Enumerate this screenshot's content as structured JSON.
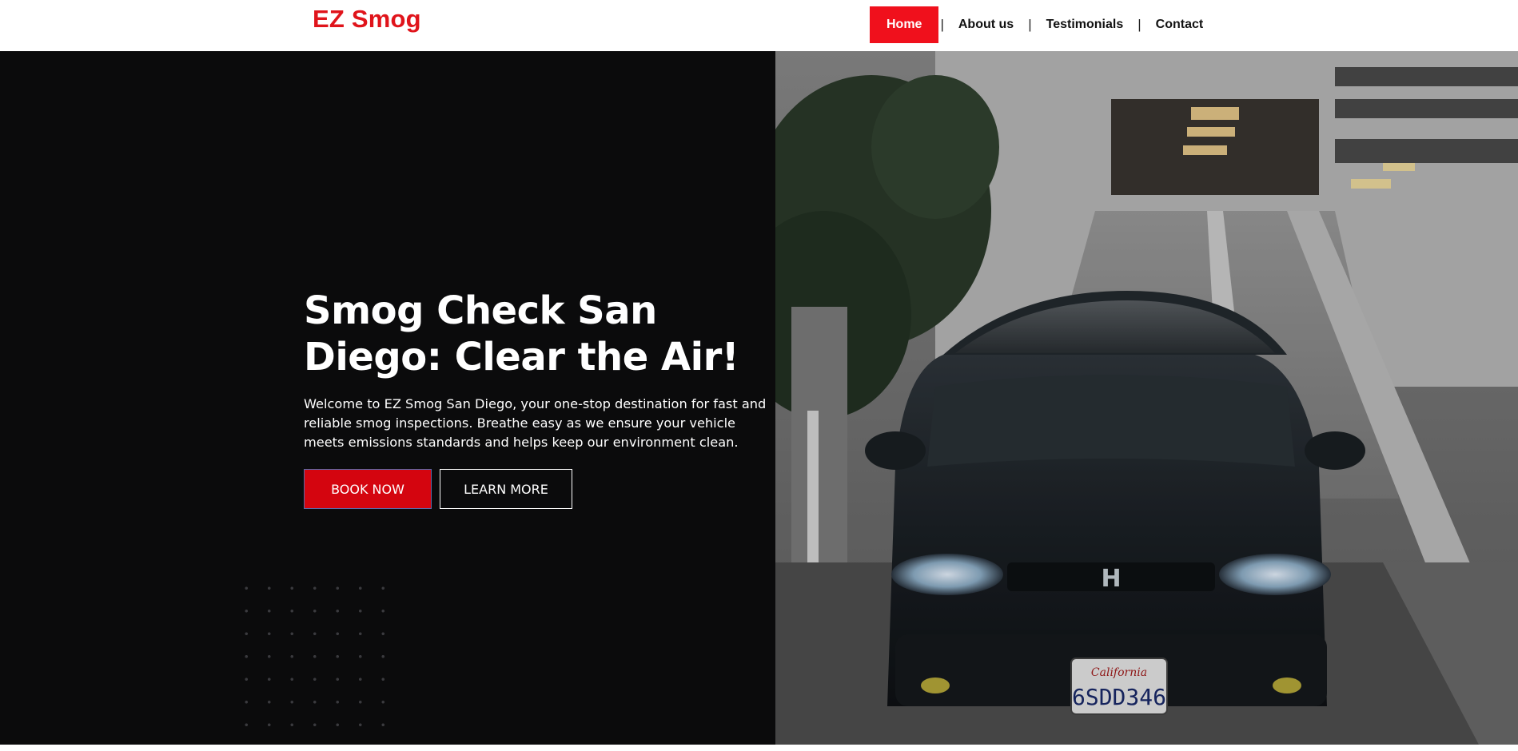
{
  "brand": {
    "logo_text": "EZ Smog",
    "accent_color": "#e0141b"
  },
  "nav": {
    "items": [
      {
        "label": "Home",
        "active": true
      },
      {
        "label": "About us",
        "active": false
      },
      {
        "label": "Testimonials",
        "active": false
      },
      {
        "label": "Contact",
        "active": false
      }
    ],
    "separator": "|"
  },
  "hero": {
    "title_line1": "Smog Check San",
    "title_line2": "Diego: Clear the Air!",
    "intro_line1": "Welcome to EZ Smog San Diego, your one-stop destination for fast and",
    "intro_line2": "reliable smog inspections. Breathe easy as we ensure your vehicle",
    "intro_line3": "meets emissions standards and helps keep our environment clean.",
    "book_button": "BOOK NOW",
    "learn_button": "LEARN MORE",
    "image": {
      "icon": "car-photo",
      "plate_state": "California",
      "plate_number": "6SDD346"
    }
  }
}
